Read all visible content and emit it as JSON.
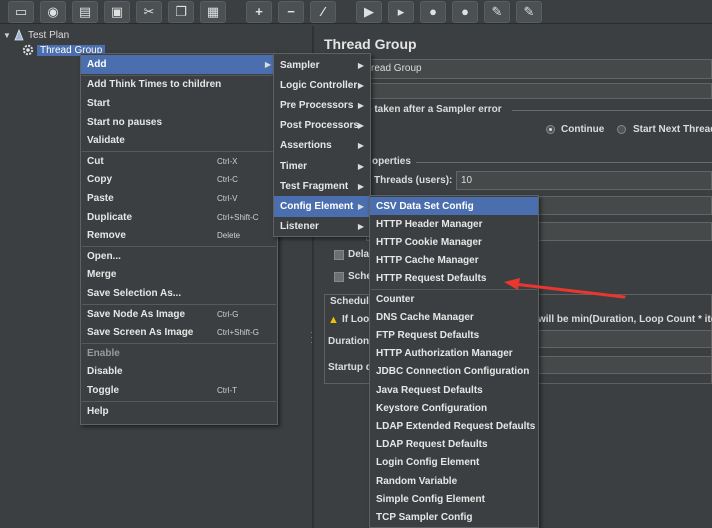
{
  "toolbar": {
    "buttons": [
      {
        "icon": "new-icon",
        "glyph": "▭"
      },
      {
        "icon": "templates-icon",
        "glyph": "◉"
      },
      {
        "icon": "open-icon",
        "glyph": "▤"
      },
      {
        "icon": "save-icon",
        "glyph": "▣"
      },
      {
        "icon": "cut-icon",
        "glyph": "✂"
      },
      {
        "icon": "copy-icon",
        "glyph": "❐"
      },
      {
        "icon": "paste-icon",
        "glyph": "▦"
      },
      {
        "icon": "expand-icon",
        "glyph": "+"
      },
      {
        "icon": "collapse-icon",
        "glyph": "−"
      },
      {
        "icon": "toggle-icon",
        "glyph": "⁄"
      },
      {
        "icon": "start-icon",
        "glyph": "▶"
      },
      {
        "icon": "start-no-pauses-icon",
        "glyph": "▸"
      },
      {
        "icon": "stop-icon",
        "glyph": "●"
      },
      {
        "icon": "shutdown-icon",
        "glyph": "●"
      },
      {
        "icon": "clear-icon",
        "glyph": "✎"
      },
      {
        "icon": "clear-all-icon",
        "glyph": "✎"
      }
    ]
  },
  "tree": {
    "root": "Test Plan",
    "child": "Thread Group"
  },
  "panel": {
    "title": "Thread Group",
    "name_value": "read Group",
    "error_action_label": "e taken after a Sampler error",
    "continue_label": "Continue",
    "next_thread_label": "Start Next Thread",
    "properties_label": "operties",
    "threads_label": "Threads (users):",
    "threads_value": "10",
    "delay_label": "Delay",
    "schedule_label": "Sche",
    "scheduler_box_label": "Schedule",
    "loop_warn_text": "If Loop",
    "loop_warn_text_right": "will be min(Duration, Loop Count * itera",
    "duration_label": "Duration (",
    "startup_label": "Startup d"
  },
  "menu1": {
    "items": [
      {
        "label": "Add",
        "submenu": true,
        "selected": true
      },
      {
        "sep": true
      },
      {
        "label": "Add Think Times to children"
      },
      {
        "label": "Start"
      },
      {
        "label": "Start no pauses"
      },
      {
        "label": "Validate"
      },
      {
        "sep": true
      },
      {
        "label": "Cut",
        "accel": "Ctrl-X"
      },
      {
        "label": "Copy",
        "accel": "Ctrl-C"
      },
      {
        "label": "Paste",
        "accel": "Ctrl-V"
      },
      {
        "label": "Duplicate",
        "accel": "Ctrl+Shift-C"
      },
      {
        "label": "Remove",
        "accel": "Delete"
      },
      {
        "sep": true
      },
      {
        "label": "Open..."
      },
      {
        "label": "Merge"
      },
      {
        "label": "Save Selection As..."
      },
      {
        "sep": true
      },
      {
        "label": "Save Node As Image",
        "accel": "Ctrl-G"
      },
      {
        "label": "Save Screen As Image",
        "accel": "Ctrl+Shift-G"
      },
      {
        "sep": true
      },
      {
        "label": "Enable",
        "disabled": true
      },
      {
        "label": "Disable"
      },
      {
        "label": "Toggle",
        "accel": "Ctrl-T"
      },
      {
        "sep": true
      },
      {
        "label": "Help"
      }
    ]
  },
  "menu2": {
    "items": [
      {
        "label": "Sampler",
        "submenu": true
      },
      {
        "label": "Logic Controller",
        "submenu": true
      },
      {
        "label": "Pre Processors",
        "submenu": true
      },
      {
        "label": "Post Processors",
        "submenu": true
      },
      {
        "label": "Assertions",
        "submenu": true
      },
      {
        "label": "Timer",
        "submenu": true
      },
      {
        "label": "Test Fragment",
        "submenu": true
      },
      {
        "label": "Config Element",
        "submenu": true,
        "selected": true
      },
      {
        "label": "Listener",
        "submenu": true
      }
    ]
  },
  "menu3": {
    "items": [
      {
        "label": "CSV Data Set Config",
        "selected": true
      },
      {
        "label": "HTTP Header Manager"
      },
      {
        "label": "HTTP Cookie Manager"
      },
      {
        "label": "HTTP Cache Manager"
      },
      {
        "label": "HTTP Request Defaults"
      },
      {
        "sep": true
      },
      {
        "label": "Counter"
      },
      {
        "label": "DNS Cache Manager"
      },
      {
        "label": "FTP Request Defaults"
      },
      {
        "label": "HTTP Authorization Manager"
      },
      {
        "label": "JDBC Connection Configuration"
      },
      {
        "label": "Java Request Defaults"
      },
      {
        "label": "Keystore Configuration"
      },
      {
        "label": "LDAP Extended Request Defaults"
      },
      {
        "label": "LDAP Request Defaults"
      },
      {
        "label": "Login Config Element"
      },
      {
        "label": "Random Variable"
      },
      {
        "label": "Simple Config Element"
      },
      {
        "label": "TCP Sampler Config"
      }
    ]
  },
  "colors": {
    "background": "#3c3f41",
    "selection": "#4b6eaf",
    "annotation_arrow": "#e8372f"
  }
}
